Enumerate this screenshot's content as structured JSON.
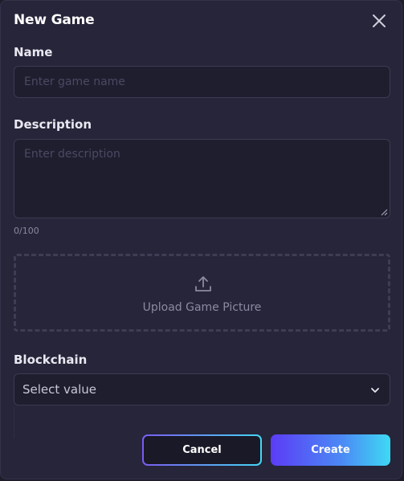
{
  "dialog": {
    "title": "New Game"
  },
  "name": {
    "label": "Name",
    "placeholder": "Enter game name",
    "value": ""
  },
  "description": {
    "label": "Description",
    "placeholder": "Enter description",
    "value": "",
    "counter": "0/100"
  },
  "upload": {
    "label": "Upload Game Picture",
    "icon": "upload-icon"
  },
  "blockchain": {
    "label": "Blockchain",
    "selected": "Select value",
    "icon": "chevron-down-icon"
  },
  "actions": {
    "cancel_label": "Cancel",
    "create_label": "Create"
  },
  "colors": {
    "background": "#262539",
    "field": "#1f1e2f",
    "accent_start": "#5b3cf6",
    "accent_end": "#3ed9f4"
  }
}
